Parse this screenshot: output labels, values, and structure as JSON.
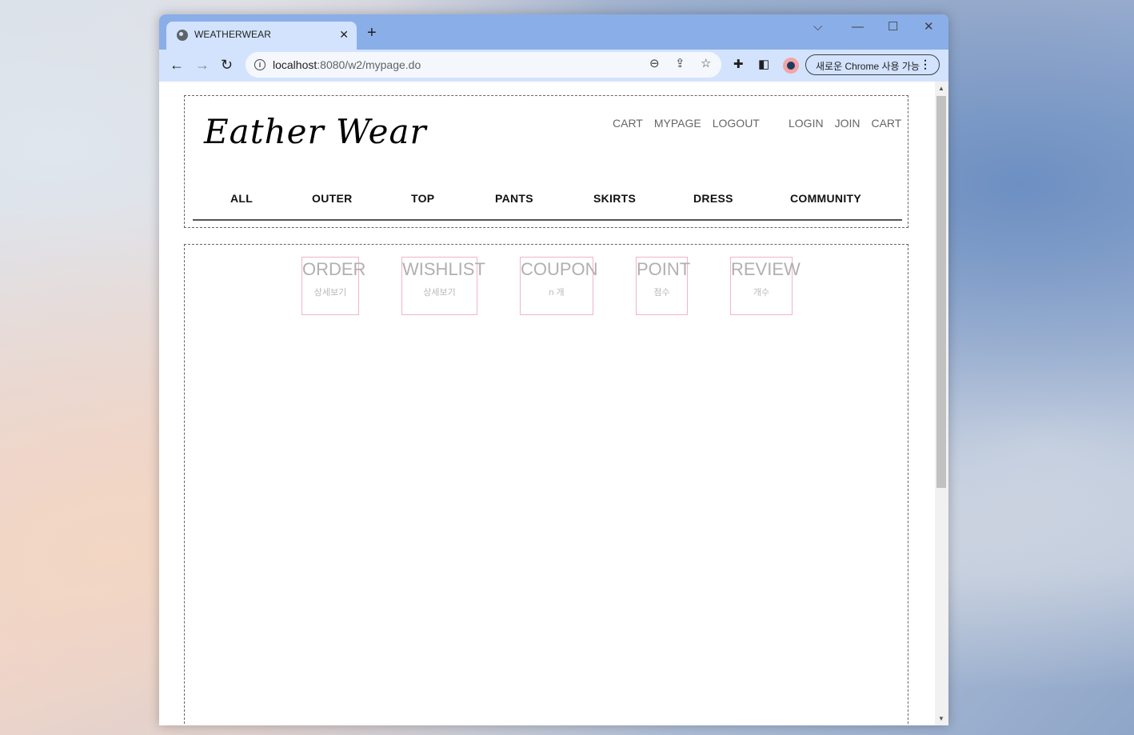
{
  "browser": {
    "tab_title": "WEATHERWEAR",
    "url_host": "localhost",
    "url_rest": ":8080/w2/mypage.do",
    "profile_pill": "새로운 Chrome 사용 가능"
  },
  "site": {
    "logo": "Eather Wear",
    "member_links": [
      "CART",
      "MYPAGE",
      "LOGOUT"
    ],
    "guest_links": [
      "LOGIN",
      "JOIN",
      "CART"
    ],
    "menu": [
      "ALL",
      "OUTER",
      "TOP",
      "PANTS",
      "SKIRTS",
      "DRESS",
      "COMMUNITY"
    ]
  },
  "mypage": {
    "cards": [
      {
        "title": "ORDER",
        "sub": "상세보기"
      },
      {
        "title": "WISHLIST",
        "sub": "상세보기"
      },
      {
        "title": "COUPON",
        "sub": "n 개"
      },
      {
        "title": "POINT",
        "sub": "점수"
      },
      {
        "title": "REVIEW",
        "sub": "개수"
      }
    ]
  }
}
